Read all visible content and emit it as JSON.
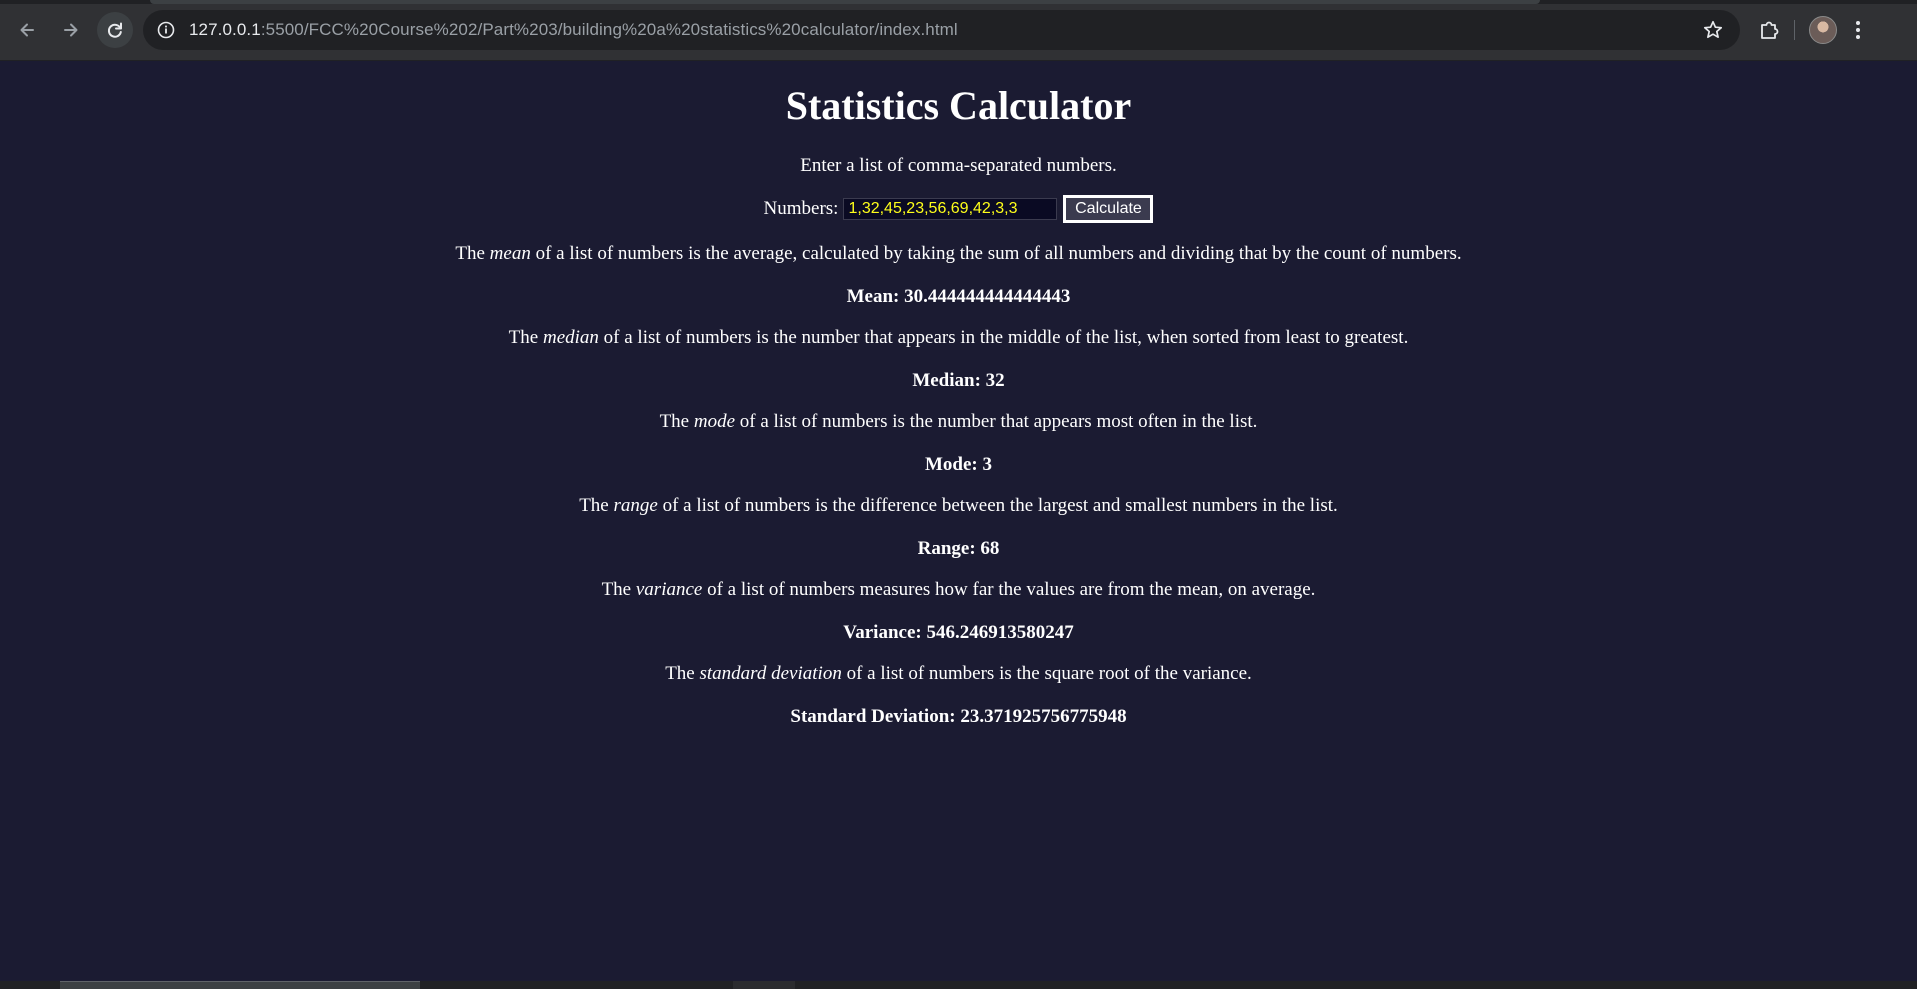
{
  "browser": {
    "url_host": "127.0.0.1",
    "url_rest": ":5500/FCC%20Course%202/Part%203/building%20a%20statistics%20calculator/index.html",
    "icons": [
      "back-arrow-icon",
      "forward-arrow-icon",
      "reload-icon",
      "site-info-icon",
      "star-icon",
      "extensions-icon",
      "profile-avatar",
      "menu-kebab-icon"
    ]
  },
  "page": {
    "title": "Statistics Calculator",
    "intro": "Enter a list of comma-separated numbers.",
    "input_label": "Numbers:",
    "input_value": "1,32,45,23,56,69,42,3,3",
    "button_label": "Calculate",
    "sections": [
      {
        "pre": "The ",
        "term": "mean",
        "post": " of a list of numbers is the average, calculated by taking the sum of all numbers and dividing that by the count of numbers.",
        "result_label": "Mean: ",
        "result_value": "30.444444444444443"
      },
      {
        "pre": "The ",
        "term": "median",
        "post": " of a list of numbers is the number that appears in the middle of the list, when sorted from least to greatest.",
        "result_label": "Median: ",
        "result_value": "32"
      },
      {
        "pre": "The ",
        "term": "mode",
        "post": " of a list of numbers is the number that appears most often in the list.",
        "result_label": "Mode: ",
        "result_value": "3"
      },
      {
        "pre": "The ",
        "term": "range",
        "post": " of a list of numbers is the difference between the largest and smallest numbers in the list.",
        "result_label": "Range: ",
        "result_value": "68"
      },
      {
        "pre": "The ",
        "term": "variance",
        "post": " of a list of numbers measures how far the values are from the mean, on average.",
        "result_label": "Variance: ",
        "result_value": "546.246913580247"
      },
      {
        "pre": "The ",
        "term": "standard deviation",
        "post": " of a list of numbers is the square root of the variance.",
        "result_label": "Standard Deviation: ",
        "result_value": "23.371925756775948"
      }
    ]
  },
  "colors": {
    "background": "#1b1b32",
    "input_text": "#fefe1a",
    "text": "#ffffff"
  }
}
